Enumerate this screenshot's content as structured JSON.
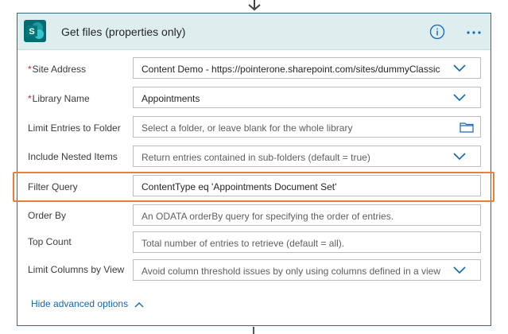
{
  "action": {
    "title": "Get files (properties only)",
    "icons": {
      "logo": "sharepoint-logo-icon",
      "info": "info-icon",
      "more": "more-options-icon"
    }
  },
  "fields": [
    {
      "label": "Site Address",
      "required": true,
      "value": "Content Demo - https://pointerone.sharepoint.com/sites/dummyClassic",
      "is_placeholder": false,
      "control": "dropdown"
    },
    {
      "label": "Library Name",
      "required": true,
      "value": "Appointments",
      "is_placeholder": false,
      "control": "dropdown"
    },
    {
      "label": "Limit Entries to Folder",
      "required": false,
      "value": "Select a folder, or leave blank for the whole library",
      "is_placeholder": true,
      "control": "folder-picker"
    },
    {
      "label": "Include Nested Items",
      "required": false,
      "value": "Return entries contained in sub-folders (default = true)",
      "is_placeholder": true,
      "control": "dropdown"
    },
    {
      "label": "Filter Query",
      "required": false,
      "value": "ContentType eq 'Appointments Document Set'",
      "is_placeholder": false,
      "control": "text"
    },
    {
      "label": "Order By",
      "required": false,
      "value": "An ODATA orderBy query for specifying the order of entries.",
      "is_placeholder": true,
      "control": "text"
    },
    {
      "label": "Top Count",
      "required": false,
      "value": "Total number of entries to retrieve (default = all).",
      "is_placeholder": true,
      "control": "text"
    },
    {
      "label": "Limit Columns by View",
      "required": false,
      "value": "Avoid column threshold issues by only using columns defined in a view",
      "is_placeholder": true,
      "control": "dropdown"
    }
  ],
  "required_marker": "*",
  "advanced_toggle": {
    "label": "Hide advanced options"
  },
  "colors": {
    "header_bg": "#deeeef",
    "card_border": "#2e6f78",
    "highlight": "#ed7d31",
    "link": "#1466b8",
    "chevron": "#1466b8",
    "required": "#c4262e"
  }
}
